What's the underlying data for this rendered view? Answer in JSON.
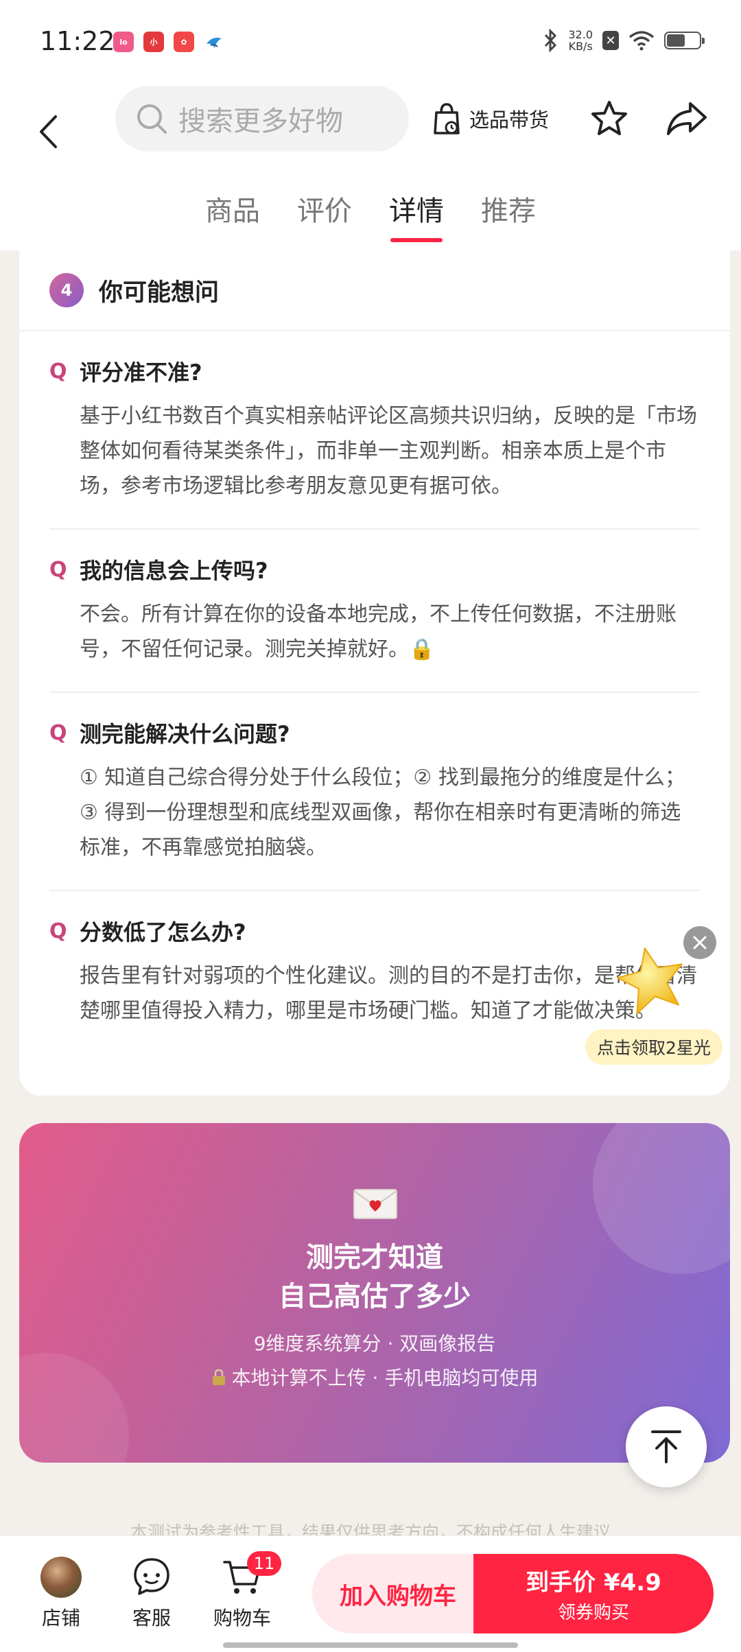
{
  "status": {
    "time": "11:22",
    "speed_value": "32.0",
    "speed_unit": "KB/s"
  },
  "header": {
    "search_placeholder": "搜索更多好物",
    "select_goods": "选品带货"
  },
  "tabs": [
    "商品",
    "评价",
    "详情",
    "推荐"
  ],
  "active_tab": "详情",
  "faq": {
    "number": "4",
    "title": "你可能想问",
    "q_mark": "Q",
    "items": [
      {
        "q": "评分准不准?",
        "a": "基于小红书数百个真实相亲帖评论区高频共识归纳，反映的是「市场整体如何看待某类条件」，而非单一主观判断。相亲本质上是个市场，参考市场逻辑比参考朋友意见更有据可依。"
      },
      {
        "q": "我的信息会上传吗?",
        "a": "不会。所有计算在你的设备本地完成，不上传任何数据，不注册账号，不留任何记录。测完关掉就好。🔒"
      },
      {
        "q": "测完能解决什么问题?",
        "a": "① 知道自己综合得分处于什么段位；② 找到最拖分的维度是什么；③ 得到一份理想型和底线型双画像，帮你在相亲时有更清晰的筛选标准，不再靠感觉拍脑袋。"
      },
      {
        "q": "分数低了怎么办?",
        "a": "报告里有针对弱项的个性化建议。测的目的不是打击你，是帮你看清楚哪里值得投入精力，哪里是市场硬门槛。知道了才能做决策。"
      }
    ]
  },
  "reward": {
    "label": "点击领取2星光"
  },
  "promo": {
    "title_line1": "测完才知道",
    "title_line2": "自己高估了多少",
    "sub1": "9维度系统算分 · 双画像报告",
    "sub2": "本地计算不上传 · 手机电脑均可使用"
  },
  "disclaimer": "本测试为参考性工具，结果仅供思考方向，不构成任何人生建议",
  "bottom": {
    "shop": "店铺",
    "service": "客服",
    "cart": "购物车",
    "cart_count": "11",
    "add_cart": "加入购物车",
    "buy_price": "到手价 ¥4.9",
    "buy_sub": "领券购买"
  },
  "colors": {
    "accent": "#ff2442",
    "q_mark": "#c8457a"
  }
}
